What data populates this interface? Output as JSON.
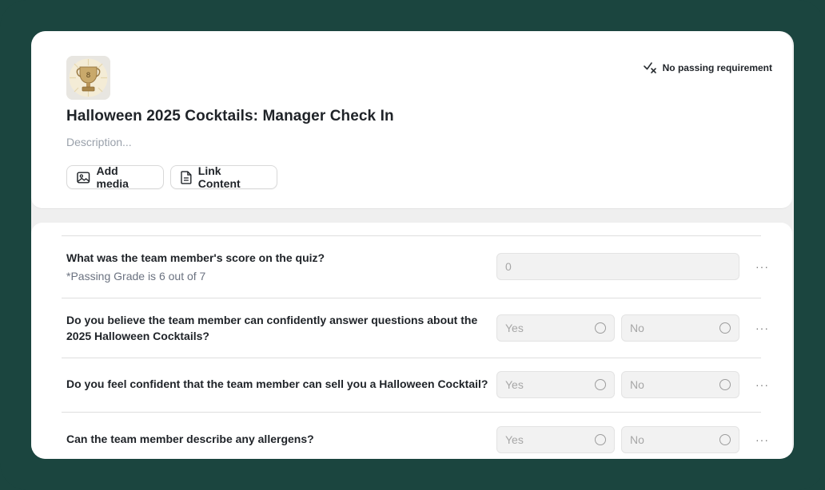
{
  "header": {
    "title": "Halloween 2025 Cocktails: Manager Check In",
    "description_placeholder": "Description...",
    "passing_requirement": "No passing requirement",
    "add_media_label": "Add media",
    "link_content_label": "Link Content",
    "trophy_digit": "8"
  },
  "questions": [
    {
      "text": "What was the team member's score on the quiz?",
      "subtext": "*Passing Grade is 6 out of 7",
      "type": "number",
      "placeholder": "0"
    },
    {
      "text": "Do you believe the team member can confidently answer questions about the 2025 Halloween Cocktails?",
      "type": "yes-no",
      "options": [
        "Yes",
        "No"
      ]
    },
    {
      "text": "Do you feel confident that the team member can sell you a Halloween Cocktail?",
      "type": "yes-no",
      "options": [
        "Yes",
        "No"
      ]
    },
    {
      "text": "Can the team member describe any allergens?",
      "type": "yes-no",
      "options": [
        "Yes",
        "No"
      ]
    }
  ],
  "more_label": "···",
  "colors": {
    "frame_background": "#1b453f",
    "card_background": "#ffffff",
    "muted_text": "#9aa1ab"
  },
  "icons": {
    "pass": "check-x-icon",
    "media": "image-icon",
    "link": "document-icon",
    "more": "more-horizontal-icon"
  }
}
